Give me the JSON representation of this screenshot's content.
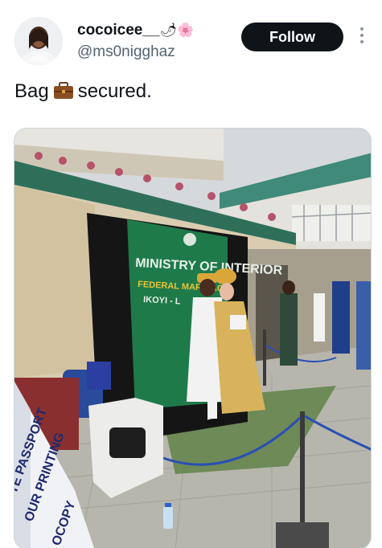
{
  "tweet": {
    "author": {
      "display_name": "cocoicee__",
      "name_emojis": "🌶🌸",
      "handle": "@ms0nigghaz"
    },
    "follow_label": "Follow",
    "text_before_emoji": "Bag",
    "emoji": "briefcase",
    "text_after_emoji": "secured."
  },
  "photo": {
    "signboard": {
      "line1": "MINISTRY OF INTERIOR",
      "line2": "FEDERAL MARRIAGE",
      "line3": "IKOYI - L"
    },
    "banner": {
      "line1": "TE PASSPORT",
      "line2": "OUR PRINTING",
      "line3": "OCOPY"
    }
  },
  "colors": {
    "follow_bg": "#0f1419",
    "handle": "#536471",
    "sign_green": "#1f7a4a",
    "sign_yellow": "#e8c53a"
  }
}
